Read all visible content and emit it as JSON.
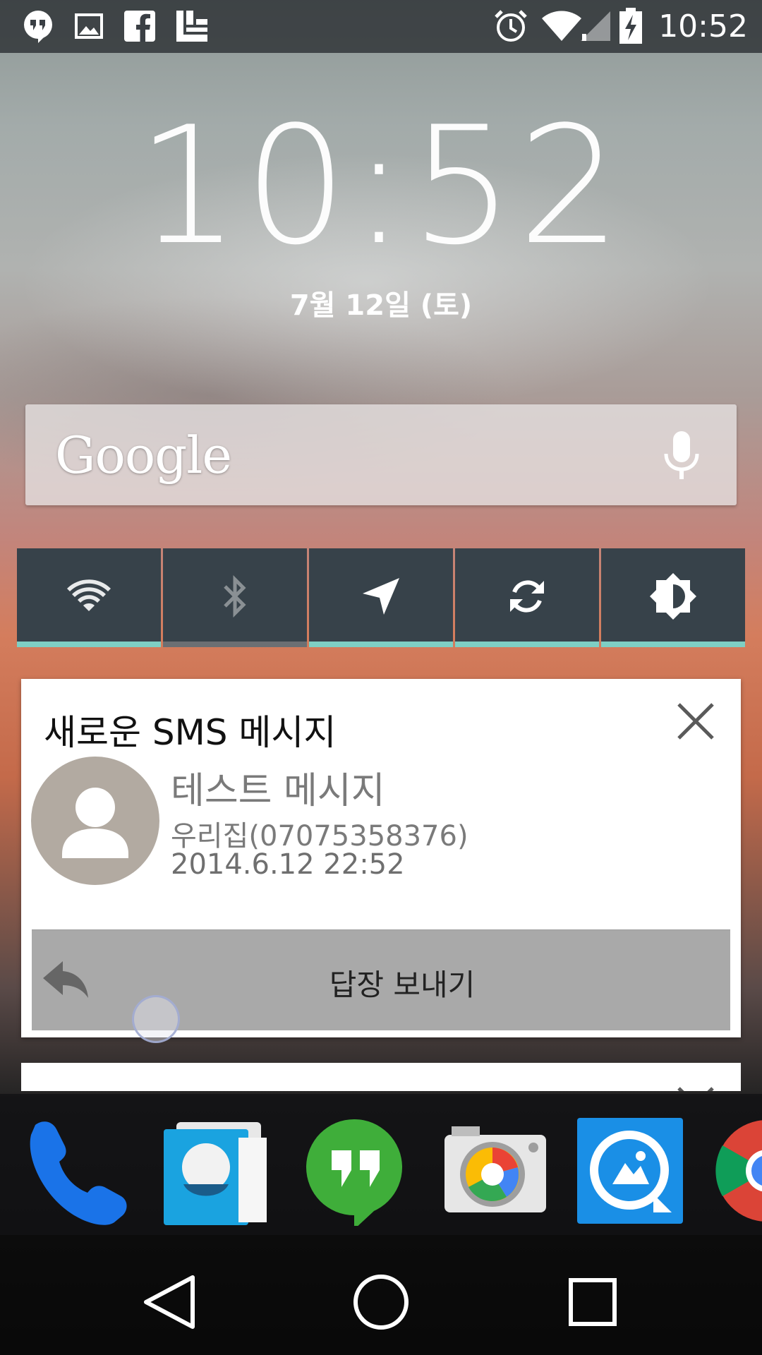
{
  "status_bar": {
    "time": "10:52",
    "left_icons": [
      "hangouts-icon",
      "image-icon",
      "facebook-icon",
      "flipboard-icon"
    ],
    "right_icons": [
      "alarm-icon",
      "wifi-icon",
      "signal-icon",
      "battery-charging-icon"
    ]
  },
  "lockscreen": {
    "clock": "10:52",
    "date": "7월 12일 (토)"
  },
  "search": {
    "logo": "Google",
    "mic_icon": "mic-icon"
  },
  "toggles": [
    {
      "name": "wifi",
      "icon": "wifi-icon",
      "active": true
    },
    {
      "name": "bluetooth",
      "icon": "bluetooth-icon",
      "active": false
    },
    {
      "name": "location",
      "icon": "location-icon",
      "active": true
    },
    {
      "name": "sync",
      "icon": "sync-icon",
      "active": true
    },
    {
      "name": "brightness",
      "icon": "brightness-icon",
      "active": true
    }
  ],
  "notification": {
    "title": "새로운 SMS 메시지",
    "sender": "테스트 메시지",
    "from": "우리집(07075358376)",
    "time": "2014.6.12 22:52",
    "reply_label": "답장 보내기"
  },
  "dock": {
    "apps": [
      "phone",
      "contacts",
      "hangouts",
      "camera",
      "gallery",
      "chrome"
    ]
  },
  "nav": [
    "back",
    "home",
    "recents"
  ],
  "colors": {
    "toggle_bg": "#37424a",
    "toggle_active": "#7ecfc4",
    "toggle_inactive": "#6b6f73",
    "reply_bg": "#a9a9a9"
  }
}
